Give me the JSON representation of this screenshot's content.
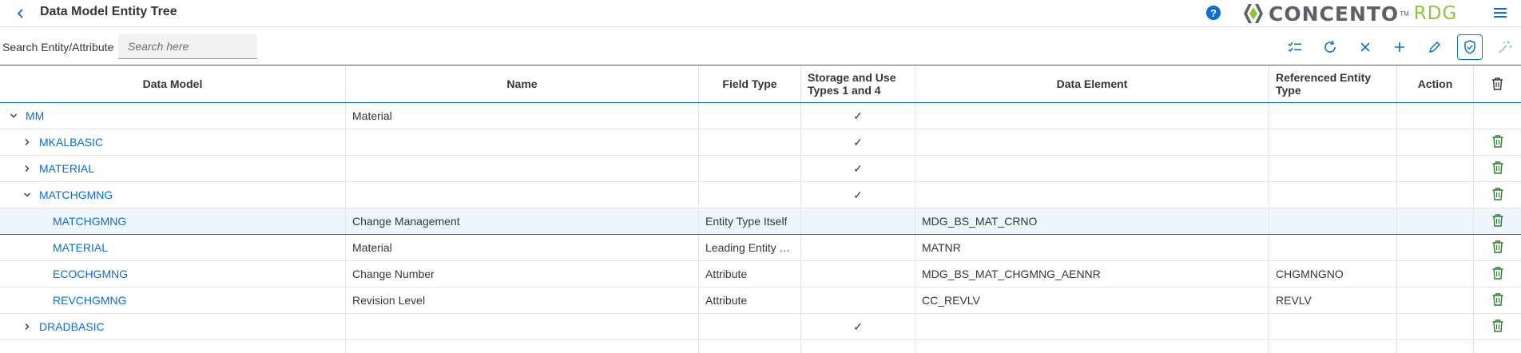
{
  "header": {
    "title": "Data Model Entity Tree",
    "back_icon": "chevron-left-icon",
    "help_icon": "help-icon",
    "help_glyph": "?",
    "logo_text": "CONCENTO",
    "logo_tm": "TM",
    "logo_suffix": "RDG",
    "menu_icon": "hamburger-menu-icon",
    "colors": {
      "accent": "#0a6ed1",
      "logo_gray": "#5d6167",
      "logo_green": "#8cc63f"
    }
  },
  "toolbar": {
    "search_label": "Search Entity/Attribute",
    "search_placeholder": "Search here",
    "search_value": "",
    "buttons": [
      {
        "icon": "multi-select-icon"
      },
      {
        "icon": "refresh-icon"
      },
      {
        "icon": "close-icon"
      },
      {
        "icon": "add-icon"
      },
      {
        "icon": "edit-icon"
      },
      {
        "icon": "shield-check-icon"
      },
      {
        "icon": "magic-wand-icon"
      }
    ]
  },
  "table": {
    "columns": [
      "Data Model",
      "Name",
      "Field Type",
      "Storage and Use Types 1 and 4",
      "Data Element",
      "Referenced Entity Type",
      "Action"
    ],
    "header_delete_icon": "trash-icon",
    "check_glyph": "✓",
    "rows": [
      {
        "level": 0,
        "caret": "down",
        "model": "MM",
        "name": "Material",
        "field_type": "",
        "storage": true,
        "data_element": "",
        "ref_entity": "",
        "delete": false,
        "selected": false
      },
      {
        "level": 1,
        "caret": "right",
        "model": "MKALBASIC",
        "name": "",
        "field_type": "",
        "storage": true,
        "data_element": "",
        "ref_entity": "",
        "delete": true,
        "selected": false
      },
      {
        "level": 1,
        "caret": "right",
        "model": "MATERIAL",
        "name": "",
        "field_type": "",
        "storage": true,
        "data_element": "",
        "ref_entity": "",
        "delete": true,
        "selected": false
      },
      {
        "level": 1,
        "caret": "down",
        "model": "MATCHGMNG",
        "name": "",
        "field_type": "",
        "storage": true,
        "data_element": "",
        "ref_entity": "",
        "delete": true,
        "selected": false
      },
      {
        "level": 2,
        "caret": "",
        "model": "MATCHGMNG",
        "name": "Change Management",
        "field_type": "Entity Type Itself",
        "storage": false,
        "data_element": "MDG_BS_MAT_CRNO",
        "ref_entity": "",
        "delete": true,
        "selected": true
      },
      {
        "level": 2,
        "caret": "",
        "model": "MATERIAL",
        "name": "Material",
        "field_type": "Leading Entity T...",
        "storage": false,
        "data_element": "MATNR",
        "ref_entity": "",
        "delete": true,
        "selected": false
      },
      {
        "level": 2,
        "caret": "",
        "model": "ECOCHGMNG",
        "name": "Change Number",
        "field_type": "Attribute",
        "storage": false,
        "data_element": "MDG_BS_MAT_CHGMNG_AENNR",
        "ref_entity": "CHGMNGNO",
        "delete": true,
        "selected": false
      },
      {
        "level": 2,
        "caret": "",
        "model": "REVCHGMNG",
        "name": "Revision Level",
        "field_type": "Attribute",
        "storage": false,
        "data_element": "CC_REVLV",
        "ref_entity": "REVLV",
        "delete": true,
        "selected": false
      },
      {
        "level": 1,
        "caret": "right",
        "model": "DRADBASIC",
        "name": "",
        "field_type": "",
        "storage": true,
        "data_element": "",
        "ref_entity": "",
        "delete": true,
        "selected": false
      },
      {
        "level": 1,
        "caret": "",
        "model": "",
        "name": "",
        "field_type": "",
        "storage": false,
        "data_element": "",
        "ref_entity": "",
        "delete": false,
        "selected": false
      }
    ]
  }
}
